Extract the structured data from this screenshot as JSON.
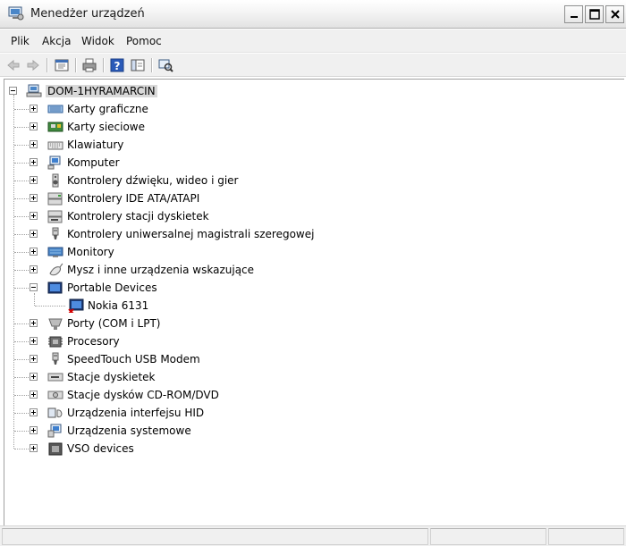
{
  "window": {
    "title": "Menedżer urządzeń",
    "controls": {
      "minimize": "minimize",
      "maximize": "maximize",
      "close": "close"
    }
  },
  "menu": {
    "items": [
      "Plik",
      "Akcja",
      "Widok",
      "Pomoc"
    ]
  },
  "toolbar": {
    "buttons": [
      "back-arrow-icon",
      "forward-arrow-icon",
      "properties-tree-icon",
      "print-icon",
      "help-icon",
      "view-icon",
      "scan-hardware-icon"
    ]
  },
  "tree": {
    "root": {
      "label": "DOM-1HYRAMARCIN",
      "icon": "computer-network-icon",
      "expanded": true
    },
    "categories": [
      {
        "label": "Karty graficzne",
        "icon": "display-adapter-icon",
        "expanded": false
      },
      {
        "label": "Karty sieciowe",
        "icon": "network-card-icon",
        "expanded": false
      },
      {
        "label": "Klawiatury",
        "icon": "keyboard-icon",
        "expanded": false
      },
      {
        "label": "Komputer",
        "icon": "computer-icon",
        "expanded": false
      },
      {
        "label": "Kontrolery dźwięku, wideo i gier",
        "icon": "speaker-icon",
        "expanded": false
      },
      {
        "label": "Kontrolery IDE ATA/ATAPI",
        "icon": "ide-controller-icon",
        "expanded": false
      },
      {
        "label": "Kontrolery stacji dyskietek",
        "icon": "floppy-controller-icon",
        "expanded": false
      },
      {
        "label": "Kontrolery uniwersalnej magistrali szeregowej",
        "icon": "usb-plug-icon",
        "expanded": false
      },
      {
        "label": "Monitory",
        "icon": "monitor-icon",
        "expanded": false
      },
      {
        "label": "Mysz i inne urządzenia wskazujące",
        "icon": "mouse-icon",
        "expanded": false
      },
      {
        "label": "Portable Devices",
        "icon": "portable-device-icon",
        "expanded": true,
        "children": [
          {
            "label": "Nokia 6131",
            "icon": "portable-device-error-icon",
            "status": "error"
          }
        ]
      },
      {
        "label": "Porty (COM i LPT)",
        "icon": "port-icon",
        "expanded": false
      },
      {
        "label": "Procesory",
        "icon": "processor-icon",
        "expanded": false
      },
      {
        "label": "SpeedTouch USB Modem",
        "icon": "usb-plug-icon",
        "expanded": false
      },
      {
        "label": "Stacje dyskietek",
        "icon": "floppy-drive-icon",
        "expanded": false
      },
      {
        "label": "Stacje dysków CD-ROM/DVD",
        "icon": "cdrom-drive-icon",
        "expanded": false
      },
      {
        "label": "Urządzenia interfejsu HID",
        "icon": "hid-device-icon",
        "expanded": false
      },
      {
        "label": "Urządzenia systemowe",
        "icon": "system-device-icon",
        "expanded": false
      },
      {
        "label": "VSO devices",
        "icon": "chip-icon",
        "expanded": false
      }
    ]
  },
  "colors": {
    "selection": "#d9d9d9",
    "error_mark": "#d40000",
    "tree_line": "#a0a0a0"
  }
}
